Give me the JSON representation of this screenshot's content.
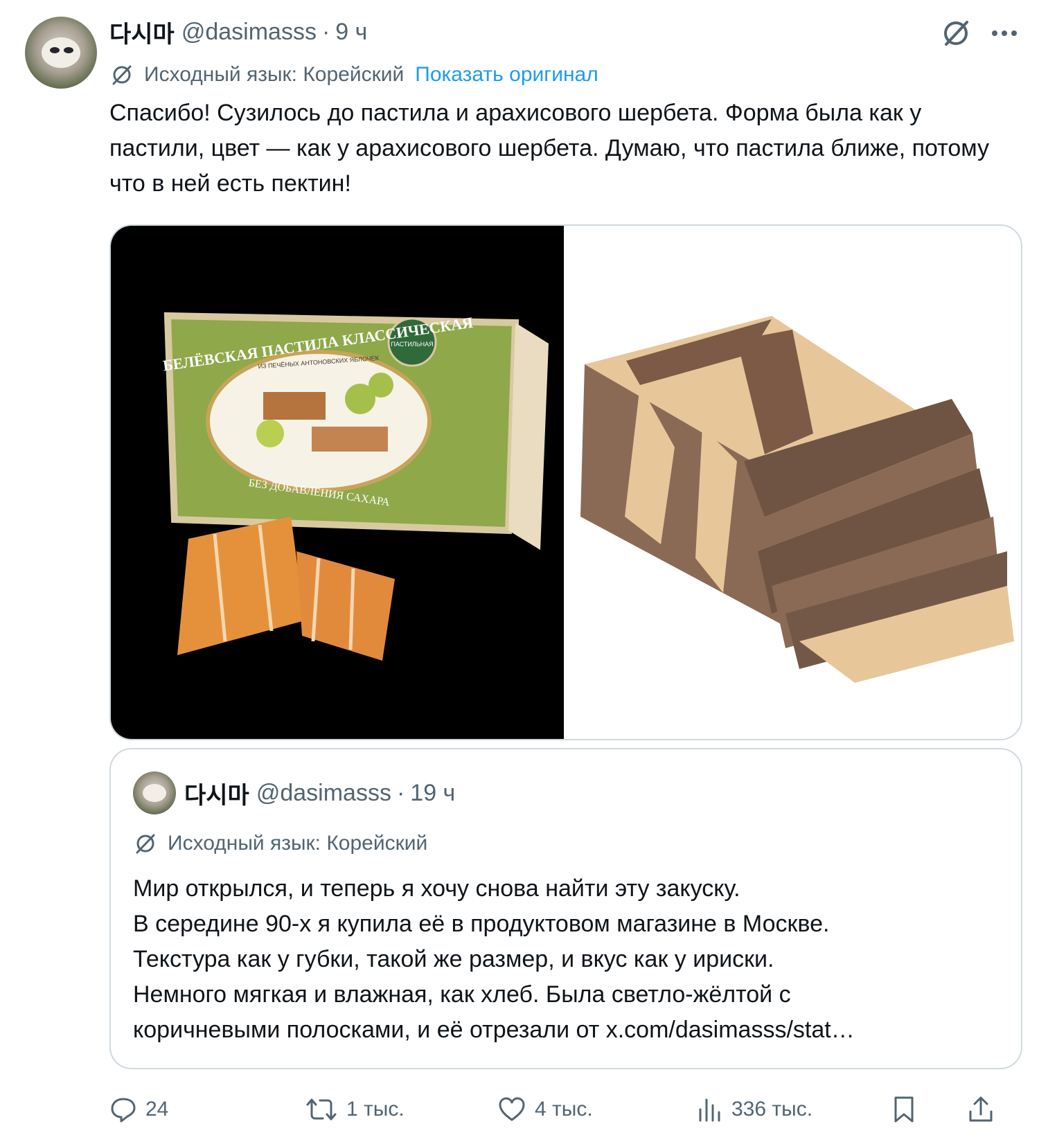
{
  "tweet": {
    "author_name": "다시마",
    "handle": "@dasimasss",
    "separator": "·",
    "time": "9 ч",
    "translation_label": "Исходный язык: Корейский",
    "show_original": "Показать оригинал",
    "text": "Спасибо! Сузилось до пастила и арахисового шербета. Форма была как у пастили, цвет — как у арахисового шербета. Думаю, что пастила ближе, потому что в ней есть пектин!",
    "images": [
      {
        "description_icon": "pastila-box-photo",
        "box_text_top": "БЕЛЁВСКАЯ ПАСТИЛА КЛАССИЧЕСКАЯ",
        "box_text_small": "ИЗ ПЕЧЁНЫХ АНТОНОВСКИХ ЯБЛОЧЕК",
        "box_text_bottom": "БЕЗ ДОБАВЛЕНИЯ САХАРА",
        "seal_text": "ПАСТИЛЬНАЯ"
      },
      {
        "description_icon": "peanut-sherbet-photo"
      }
    ]
  },
  "quote": {
    "author_name": "다시마",
    "handle": "@dasimasss",
    "separator": "·",
    "time": "19 ч",
    "translation_label": "Исходный язык: Корейский",
    "lines": [
      "Мир открылся, и теперь я хочу снова найти эту закуску.",
      "В середине 90-х я купила её в продуктовом магазине в Москве.",
      "Текстура как у губки, такой же размер, и вкус как у ириски.",
      "Немного мягкая и влажная, как хлеб. Была светло-жёлтой с",
      "коричневыми полосками, и её отрезали от x.com/dasimasss/stat…"
    ]
  },
  "actions": {
    "replies": "24",
    "reposts": "1 тыс.",
    "likes": "4 тыс.",
    "views": "336 тыс."
  },
  "colors": {
    "text": "#0f1419",
    "secondary": "#536471",
    "link": "#1d9bf0",
    "border": "#cfd9de"
  }
}
